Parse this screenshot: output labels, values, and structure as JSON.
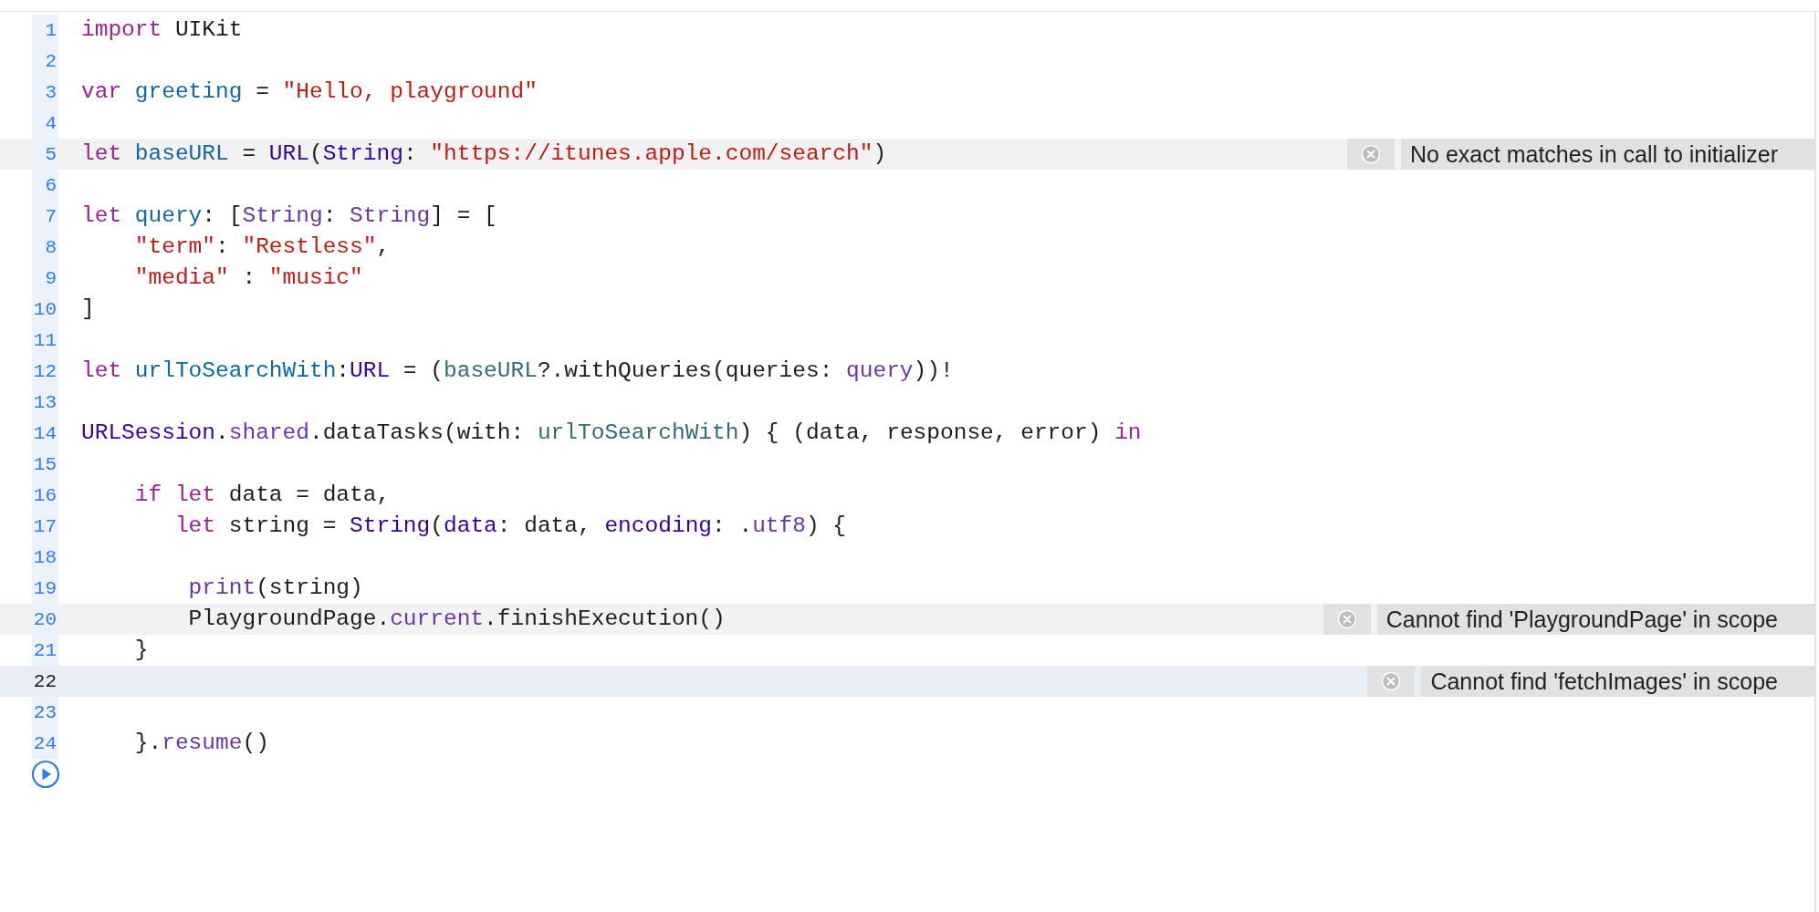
{
  "editor": {
    "lines": [
      {
        "number": "1",
        "selected": false,
        "tokens": [
          {
            "kind": "keyword",
            "text": "import"
          },
          {
            "kind": "plain",
            "text": " UIKit"
          }
        ]
      },
      {
        "number": "2",
        "selected": false
      },
      {
        "number": "3",
        "selected": false,
        "tokens": [
          {
            "kind": "keyword",
            "text": "var "
          },
          {
            "kind": "decl",
            "text": "greeting"
          },
          {
            "kind": "plain",
            "text": " = "
          },
          {
            "kind": "string",
            "text": "\"Hello, playground\""
          }
        ]
      },
      {
        "number": "4",
        "selected": false
      },
      {
        "number": "5",
        "selected": false,
        "error": "No exact matches in call to initializer",
        "tokens": [
          {
            "kind": "keyword",
            "text": "let "
          },
          {
            "kind": "decl",
            "text": "baseURL"
          },
          {
            "kind": "plain",
            "text": " = "
          },
          {
            "kind": "type",
            "text": "URL"
          },
          {
            "kind": "plain",
            "text": "("
          },
          {
            "kind": "type",
            "text": "String"
          },
          {
            "kind": "plain",
            "text": ": "
          },
          {
            "kind": "string",
            "text": "\"https://itunes.apple.com/search\""
          },
          {
            "kind": "plain",
            "text": ")"
          }
        ]
      },
      {
        "number": "6",
        "selected": false
      },
      {
        "number": "7",
        "selected": false,
        "tokens": [
          {
            "kind": "keyword",
            "text": "let "
          },
          {
            "kind": "decl",
            "text": "query"
          },
          {
            "kind": "plain",
            "text": ": ["
          },
          {
            "kind": "member",
            "text": "String"
          },
          {
            "kind": "plain",
            "text": ": "
          },
          {
            "kind": "member",
            "text": "String"
          },
          {
            "kind": "plain",
            "text": "] = ["
          }
        ]
      },
      {
        "number": "8",
        "selected": false,
        "tokens": [
          {
            "kind": "string",
            "text": "    \"term\""
          },
          {
            "kind": "plain",
            "text": ": "
          },
          {
            "kind": "string",
            "text": "\"Restless\""
          },
          {
            "kind": "plain",
            "text": ","
          }
        ]
      },
      {
        "number": "9",
        "selected": false,
        "tokens": [
          {
            "kind": "string",
            "text": "    \"media\""
          },
          {
            "kind": "plain",
            "text": " : "
          },
          {
            "kind": "string",
            "text": "\"music\""
          }
        ]
      },
      {
        "number": "10",
        "selected": false,
        "tokens": [
          {
            "kind": "plain",
            "text": "]"
          }
        ]
      },
      {
        "number": "11",
        "selected": false
      },
      {
        "number": "12",
        "selected": false,
        "tokens": [
          {
            "kind": "keyword",
            "text": "let "
          },
          {
            "kind": "decl",
            "text": "urlToSearchWith"
          },
          {
            "kind": "plain",
            "text": ":"
          },
          {
            "kind": "type",
            "text": "URL"
          },
          {
            "kind": "plain",
            "text": " = ("
          },
          {
            "kind": "ref",
            "text": "baseURL"
          },
          {
            "kind": "plain",
            "text": "?.withQueries(queries: "
          },
          {
            "kind": "member",
            "text": "query"
          },
          {
            "kind": "plain",
            "text": "))!"
          }
        ]
      },
      {
        "number": "13",
        "selected": false
      },
      {
        "number": "14",
        "selected": false,
        "tokens": [
          {
            "kind": "type",
            "text": "URLSession"
          },
          {
            "kind": "plain",
            "text": "."
          },
          {
            "kind": "member",
            "text": "shared"
          },
          {
            "kind": "plain",
            "text": ".dataTasks(with: "
          },
          {
            "kind": "ref",
            "text": "urlToSearchWith"
          },
          {
            "kind": "plain",
            "text": ") { (data, response, error) "
          },
          {
            "kind": "keyword",
            "text": "in"
          }
        ]
      },
      {
        "number": "15",
        "selected": false
      },
      {
        "number": "16",
        "selected": false,
        "tokens": [
          {
            "kind": "keyword",
            "text": "    if"
          },
          {
            "kind": "keyword",
            "text": " let"
          },
          {
            "kind": "plain",
            "text": " data = data,"
          }
        ]
      },
      {
        "number": "17",
        "selected": false,
        "tokens": [
          {
            "kind": "keyword",
            "text": "       let"
          },
          {
            "kind": "plain",
            "text": " string = "
          },
          {
            "kind": "type",
            "text": "String"
          },
          {
            "kind": "plain",
            "text": "("
          },
          {
            "kind": "type",
            "text": "data"
          },
          {
            "kind": "plain",
            "text": ": data, "
          },
          {
            "kind": "type",
            "text": "encoding"
          },
          {
            "kind": "plain",
            "text": ": ."
          },
          {
            "kind": "member",
            "text": "utf8"
          },
          {
            "kind": "plain",
            "text": ") {"
          }
        ]
      },
      {
        "number": "18",
        "selected": false
      },
      {
        "number": "19",
        "selected": false,
        "tokens": [
          {
            "kind": "member",
            "text": "        print"
          },
          {
            "kind": "plain",
            "text": "(string)"
          }
        ]
      },
      {
        "number": "20",
        "selected": false,
        "error": "Cannot find 'PlaygroundPage' in scope",
        "tokens": [
          {
            "kind": "plain",
            "text": "        PlaygroundPage."
          },
          {
            "kind": "member",
            "text": "current"
          },
          {
            "kind": "plain",
            "text": ".finishExecution()"
          }
        ]
      },
      {
        "number": "21",
        "selected": false,
        "tokens": [
          {
            "kind": "plain",
            "text": "    }"
          }
        ]
      },
      {
        "number": "22",
        "selected": true,
        "error": "Cannot find 'fetchImages' in scope"
      },
      {
        "number": "23",
        "selected": false
      },
      {
        "number": "24",
        "selected": false,
        "tokens": [
          {
            "kind": "plain",
            "text": "    }."
          },
          {
            "kind": "member",
            "text": "resume"
          },
          {
            "kind": "plain",
            "text": "()"
          }
        ]
      }
    ]
  }
}
